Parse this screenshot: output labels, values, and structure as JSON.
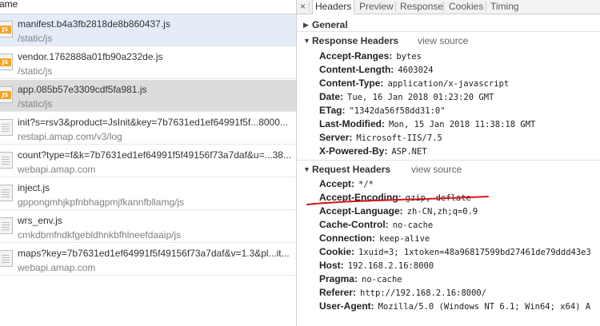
{
  "left_header": "ame",
  "requests": [
    {
      "name": "manifest.b4a3fb2818de8b860437.js",
      "path": "/static/js",
      "icon": "js-file-icon",
      "state": "selected"
    },
    {
      "name": "vendor.1762888a01fb90a232de.js",
      "path": "/static/js",
      "icon": "js-file-icon",
      "state": ""
    },
    {
      "name": "app.085b57e3309cdf5fa981.js",
      "path": "/static/js",
      "icon": "js-file-icon",
      "state": "hovered"
    },
    {
      "name": "init?s=rsv3&product=JsInit&key=7b7631ed1ef64991f5f...8000...",
      "path": "restapi.amap.com/v3/log",
      "icon": "document-icon",
      "state": ""
    },
    {
      "name": "count?type=f&k=7b7631ed1ef64991f5f49156f73a7daf&u=...38...",
      "path": "webapi.amap.com",
      "icon": "document-icon",
      "state": ""
    },
    {
      "name": "inject.js",
      "path": "gppongmhjkpfnbhagpmjfkannfbllamg/js",
      "icon": "document-icon",
      "state": ""
    },
    {
      "name": "wrs_env.js",
      "path": "cmkdbmfndkfgebldhnkbfhlneefdaaip/js",
      "icon": "document-icon",
      "state": ""
    },
    {
      "name": "maps?key=7b7631ed1ef64991f5f49156f73a7daf&v=1.3&pl...it...",
      "path": "webapi.amap.com",
      "icon": "document-icon",
      "state": ""
    }
  ],
  "tabs": [
    "Headers",
    "Preview",
    "Response",
    "Cookies",
    "Timing"
  ],
  "close_icon": "×",
  "general_label": "General",
  "response_headers": {
    "label": "Response Headers",
    "view_source": "view source",
    "items": [
      {
        "key": "Accept-Ranges:",
        "value": "bytes"
      },
      {
        "key": "Content-Length:",
        "value": "4603024"
      },
      {
        "key": "Content-Type:",
        "value": "application/x-javascript"
      },
      {
        "key": "Date:",
        "value": "Tue, 16 Jan 2018 01:23:20 GMT"
      },
      {
        "key": "ETag:",
        "value": "\"1342da56f58dd31:0\""
      },
      {
        "key": "Last-Modified:",
        "value": "Mon, 15 Jan 2018 11:38:18 GMT"
      },
      {
        "key": "Server:",
        "value": "Microsoft-IIS/7.5"
      },
      {
        "key": "X-Powered-By:",
        "value": "ASP.NET"
      }
    ]
  },
  "request_headers": {
    "label": "Request Headers",
    "view_source": "view source",
    "items": [
      {
        "key": "Accept:",
        "value": "*/*"
      },
      {
        "key": "Accept-Encoding:",
        "value": "gzip, deflate"
      },
      {
        "key": "Accept-Language:",
        "value": "zh-CN,zh;q=0.9"
      },
      {
        "key": "Cache-Control:",
        "value": "no-cache"
      },
      {
        "key": "Connection:",
        "value": "keep-alive"
      },
      {
        "key": "Cookie:",
        "value": "1xuid=3; 1xtoken=48a96817599bd27461de79ddd43e3"
      },
      {
        "key": "Host:",
        "value": "192.168.2.16:8000"
      },
      {
        "key": "Pragma:",
        "value": "no-cache"
      },
      {
        "key": "Referer:",
        "value": "http://192.168.2.16:8000/"
      },
      {
        "key": "User-Agent:",
        "value": "Mozilla/5.0 (Windows NT 6.1; Win64; x64) A"
      }
    ]
  },
  "annotation_color": "#d9141c"
}
